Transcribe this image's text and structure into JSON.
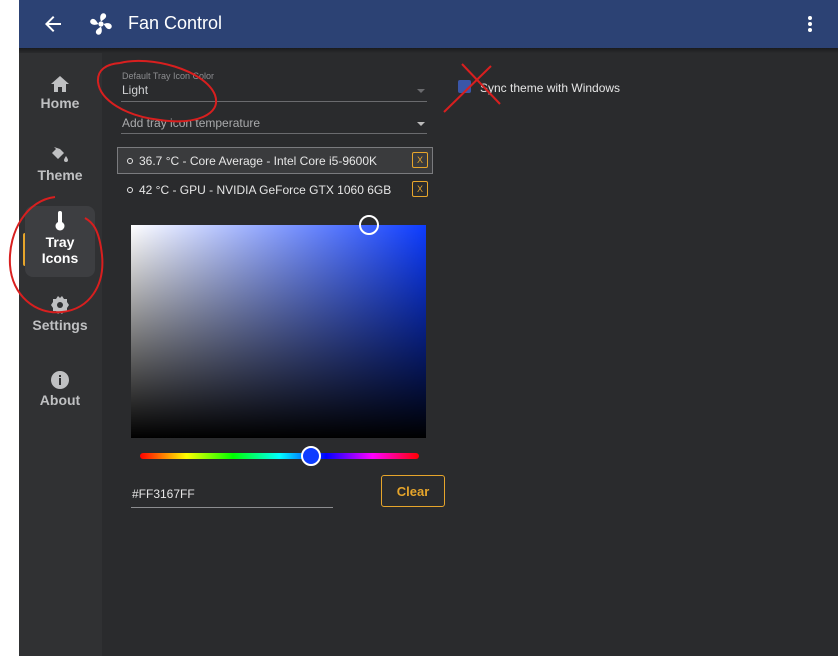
{
  "titlebar": {
    "title": "Fan Control",
    "back_icon": "arrow-left-icon",
    "app_icon": "fan-icon",
    "menu_icon": "more-vertical-icon"
  },
  "sidebar": {
    "items": [
      {
        "label": "Home",
        "icon": "home-icon"
      },
      {
        "label": "Theme",
        "icon": "paint-bucket-icon"
      },
      {
        "label": "Tray Icons",
        "label_line1": "Tray",
        "label_line2": "Icons",
        "icon": "thermometer-icon",
        "active": true
      },
      {
        "label": "Settings",
        "icon": "gear-icon"
      },
      {
        "label": "About",
        "icon": "info-icon"
      }
    ],
    "active_accent": "#e6a52b"
  },
  "tray": {
    "default_color_label": "Default Tray Icon Color",
    "default_color_value": "Light",
    "add_temp_placeholder": "Add tray icon temperature",
    "sensors": [
      {
        "text": "36.7 °C - Core Average - Intel Core i5-9600K",
        "remove": "X",
        "selected": true
      },
      {
        "text": "42 °C - GPU - NVIDIA GeForce GTX 1060 6GB",
        "remove": "X",
        "selected": false
      }
    ],
    "color_picker": {
      "hex_value": "#FF3167FF",
      "hue_color": "#0d3cff",
      "clear_label": "Clear"
    }
  },
  "sync": {
    "label": "Sync theme with Windows",
    "checked": true
  },
  "colors": {
    "titlebar": "#2c4274",
    "background": "#2a2b2d",
    "sidebar": "#303133",
    "accent": "#e6a52b",
    "annotation": "#d81f1f"
  }
}
